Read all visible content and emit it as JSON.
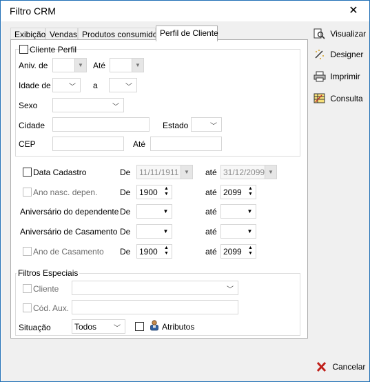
{
  "window": {
    "title": "Filtro CRM",
    "close_glyph": "✕"
  },
  "tabs": [
    {
      "label": "Exibição"
    },
    {
      "label": "Vendas"
    },
    {
      "label": "Produtos consumidos"
    },
    {
      "label": "Perfil de Cliente"
    }
  ],
  "cliente_perfil": {
    "group_label": "Cliente Perfil",
    "aniv_de_label": "Aniv. de",
    "ate_label": "Até",
    "idade_de_label": "Idade de",
    "a_label": "a",
    "sexo_label": "Sexo",
    "cidade_label": "Cidade",
    "estado_label": "Estado",
    "cep_label": "CEP",
    "cep_ate_label": "Até"
  },
  "date_filters": {
    "data_cadastro": {
      "label": "Data Cadastro",
      "de_label": "De",
      "from": "11/11/1911",
      "ate_label": "até",
      "to": "31/12/2099"
    },
    "ano_nasc": {
      "label": "Ano nasc. depen.",
      "de_label": "De",
      "from": "1900",
      "ate_label": "até",
      "to": "2099"
    },
    "aniv_dependente": {
      "label": "Aniversário do dependente",
      "de_label": "De",
      "ate_label": "até"
    },
    "aniv_casamento": {
      "label": "Aniversário de Casamento",
      "de_label": "De",
      "ate_label": "até"
    },
    "ano_casamento": {
      "label": "Ano de Casamento",
      "de_label": "De",
      "from": "1900",
      "ate_label": "até",
      "to": "2099"
    }
  },
  "filtros_especiais": {
    "group_label": "Filtros Especiais",
    "cliente_label": "Cliente",
    "cod_aux_label": "Cód. Aux.",
    "situacao_label": "Situação",
    "situacao_value": "Todos",
    "atributos_label": "Atributos"
  },
  "side_buttons": {
    "visualizar": "Visualizar",
    "designer": "Designer",
    "imprimir": "Imprimir",
    "consulta": "Consulta",
    "cancelar": "Cancelar"
  }
}
